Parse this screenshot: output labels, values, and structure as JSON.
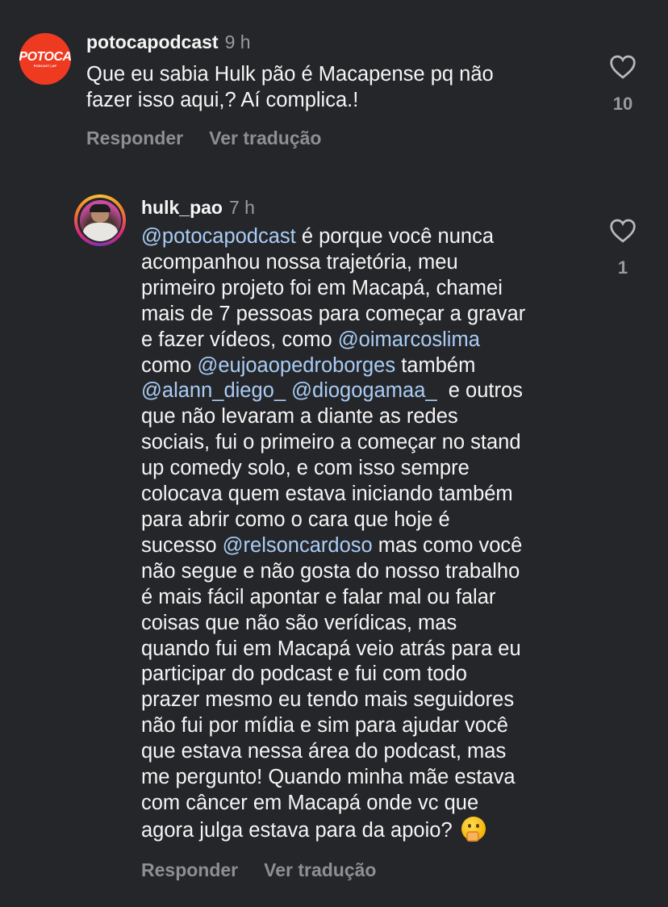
{
  "comments": [
    {
      "avatar_logo": "POTOCA",
      "avatar_logo_sub": "PODCAST | AP",
      "username": "potocapodcast",
      "time": "9 h",
      "lines": [
        "Que eu sabia Hulk pão é Macapense pq não",
        "fazer isso aqui,? Aí complica.!"
      ],
      "reply_label": "Responder",
      "translate_label": "Ver tradução",
      "likes": "10",
      "icon": "heart-outline-icon"
    },
    {
      "username": "hulk_pao",
      "time": "7 h",
      "mentions": {
        "m1": "@potocapodcast",
        "m2": "@oimarcoslima",
        "m3": "@eujoaopedroborges",
        "m4": "@alann_diego_",
        "m5": "@diogogamaa_",
        "m6": "@relsoncardoso"
      },
      "text": {
        "l1_after": " é porque você nunca",
        "l2": "acompanhou nossa trajetória, meu",
        "l3": "primeiro projeto foi em Macapá, chamei",
        "l4": "mais de 7 pessoas para começar a gravar",
        "l5_before": "e fazer vídeos, como ",
        "l6_before": "como ",
        "l6_after": " também",
        "l7_mid": " ",
        "l7_after": "  e outros",
        "l8": "que não levaram a diante as redes",
        "l9": "sociais, fui o primeiro a começar no stand",
        "l10": "up comedy solo, e com isso sempre",
        "l11": "colocava quem estava iniciando também",
        "l12": "para abrir como o cara que hoje é",
        "l13_before": "sucesso ",
        "l13_after": " mas como você",
        "l14": "não segue e não gosta do nosso trabalho",
        "l15": "é mais fácil apontar e falar mal ou falar",
        "l16": "coisas que não são verídicas, mas",
        "l17": "quando fui em Macapá veio atrás para eu",
        "l18": "participar do podcast e fui com todo",
        "l19": "prazer mesmo eu tendo mais seguidores",
        "l20": "não fui por mídia e sim para ajudar você",
        "l21": "que estava nessa área do podcast, mas",
        "l22": "me pergunto! Quando minha mãe estava",
        "l23": "com câncer em Macapá onde vc que",
        "l24": "agora julga estava para da apoio? "
      },
      "emoji": "thinking-face-emoji",
      "reply_label": "Responder",
      "translate_label": "Ver tradução",
      "likes": "1",
      "icon": "heart-outline-icon"
    }
  ]
}
